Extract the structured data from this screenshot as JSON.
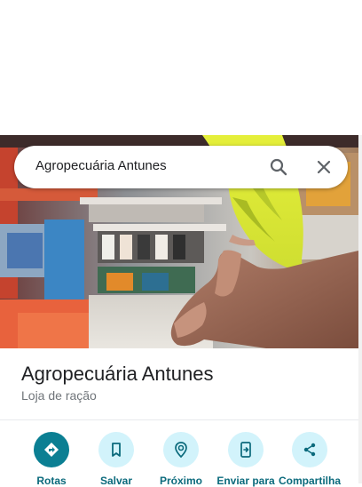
{
  "search": {
    "query": "Agropecuária Antunes",
    "search_icon": "search-icon",
    "close_icon": "close-icon"
  },
  "place": {
    "name": "Agropecuária Antunes",
    "category": "Loja de ração",
    "photo_description": "Photo: parakeet perched on hand inside store"
  },
  "actions": [
    {
      "label": "Rotas",
      "icon": "directions-icon"
    },
    {
      "label": "Salvar",
      "icon": "bookmark-icon"
    },
    {
      "label": "Próximo",
      "icon": "nearby-icon"
    },
    {
      "label": "Enviar para",
      "icon": "send-to-phone-icon"
    },
    {
      "label": "Compartilha",
      "icon": "share-icon"
    }
  ],
  "colors": {
    "accent": "#0b7f93",
    "action_bg": "#d2f3fb",
    "action_label": "#0b6a7c",
    "text_primary": "#202124",
    "text_secondary": "#70757a"
  }
}
